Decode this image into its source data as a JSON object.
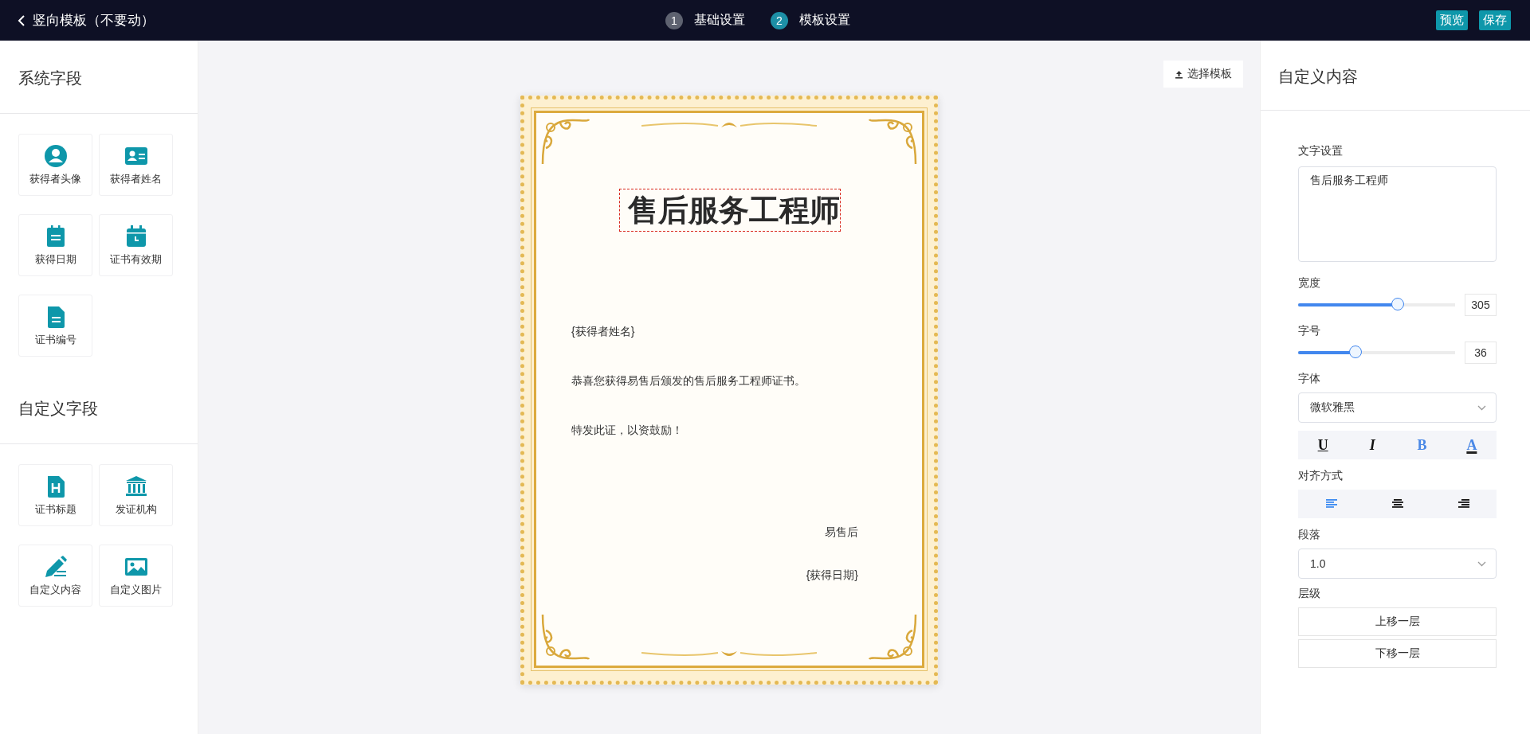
{
  "header": {
    "back_title": "竖向模板（不要动）",
    "steps": [
      {
        "number": "1",
        "label": "基础设置",
        "selected": false
      },
      {
        "number": "2",
        "label": "模板设置",
        "selected": true
      }
    ],
    "buttons": [
      "预览",
      "保存"
    ]
  },
  "left_panel": {
    "sections": [
      {
        "title": "系统字段",
        "items": [
          {
            "label": "获得者头像",
            "kind": "avatar"
          },
          {
            "label": "获得者姓名",
            "kind": "idcard"
          },
          {
            "label": "获得日期",
            "kind": "notepad"
          },
          {
            "label": "证书有效期",
            "kind": "calendar"
          },
          {
            "label": "证书编号",
            "kind": "document"
          }
        ]
      },
      {
        "title": "自定义字段",
        "items": [
          {
            "label": "证书标题",
            "kind": "heading"
          },
          {
            "label": "发证机构",
            "kind": "institution"
          },
          {
            "label": "自定义内容",
            "kind": "pen"
          },
          {
            "label": "自定义图片",
            "kind": "image"
          }
        ]
      }
    ]
  },
  "canvas": {
    "choose_template_button": "选择模板",
    "certificate": {
      "title": "售后服务工程师",
      "title_selected": true,
      "lines": [
        {
          "text": "{获得者姓名}",
          "kind": "name"
        },
        {
          "text": "恭喜您获得易售后颁发的售后服务工程师证书。",
          "kind": "body"
        },
        {
          "text": "特发此证，以资鼓励！",
          "kind": "body"
        },
        {
          "text": "易售后",
          "kind": "signature"
        },
        {
          "text": "{获得日期}",
          "kind": "date"
        }
      ]
    }
  },
  "right_panel": {
    "title": "自定义内容",
    "text_label": "文字设置",
    "text_value": "售后服务工程师",
    "sliders": [
      {
        "label": "宽度",
        "level": 0.64,
        "value": "305"
      },
      {
        "label": "字号",
        "level": 0.37,
        "value": "36"
      }
    ],
    "font": {
      "label": "字体",
      "value": "微软雅黑"
    },
    "styles": [
      {
        "kind": "underline",
        "glyph": "U",
        "selected": false
      },
      {
        "kind": "italic",
        "glyph": "I",
        "selected": false
      },
      {
        "kind": "bold",
        "glyph": "B",
        "selected": true
      },
      {
        "kind": "color",
        "glyph": "A",
        "selected": true
      }
    ],
    "align_label": "对齐方式",
    "aligns": [
      {
        "kind": "left",
        "selected": true
      },
      {
        "kind": "center",
        "selected": false
      },
      {
        "kind": "right",
        "selected": false
      }
    ],
    "paragraph": {
      "label": "段落",
      "value": "1.0"
    },
    "layer": {
      "label": "层级",
      "buttons": [
        "上移一层",
        "下移一层"
      ]
    }
  }
}
